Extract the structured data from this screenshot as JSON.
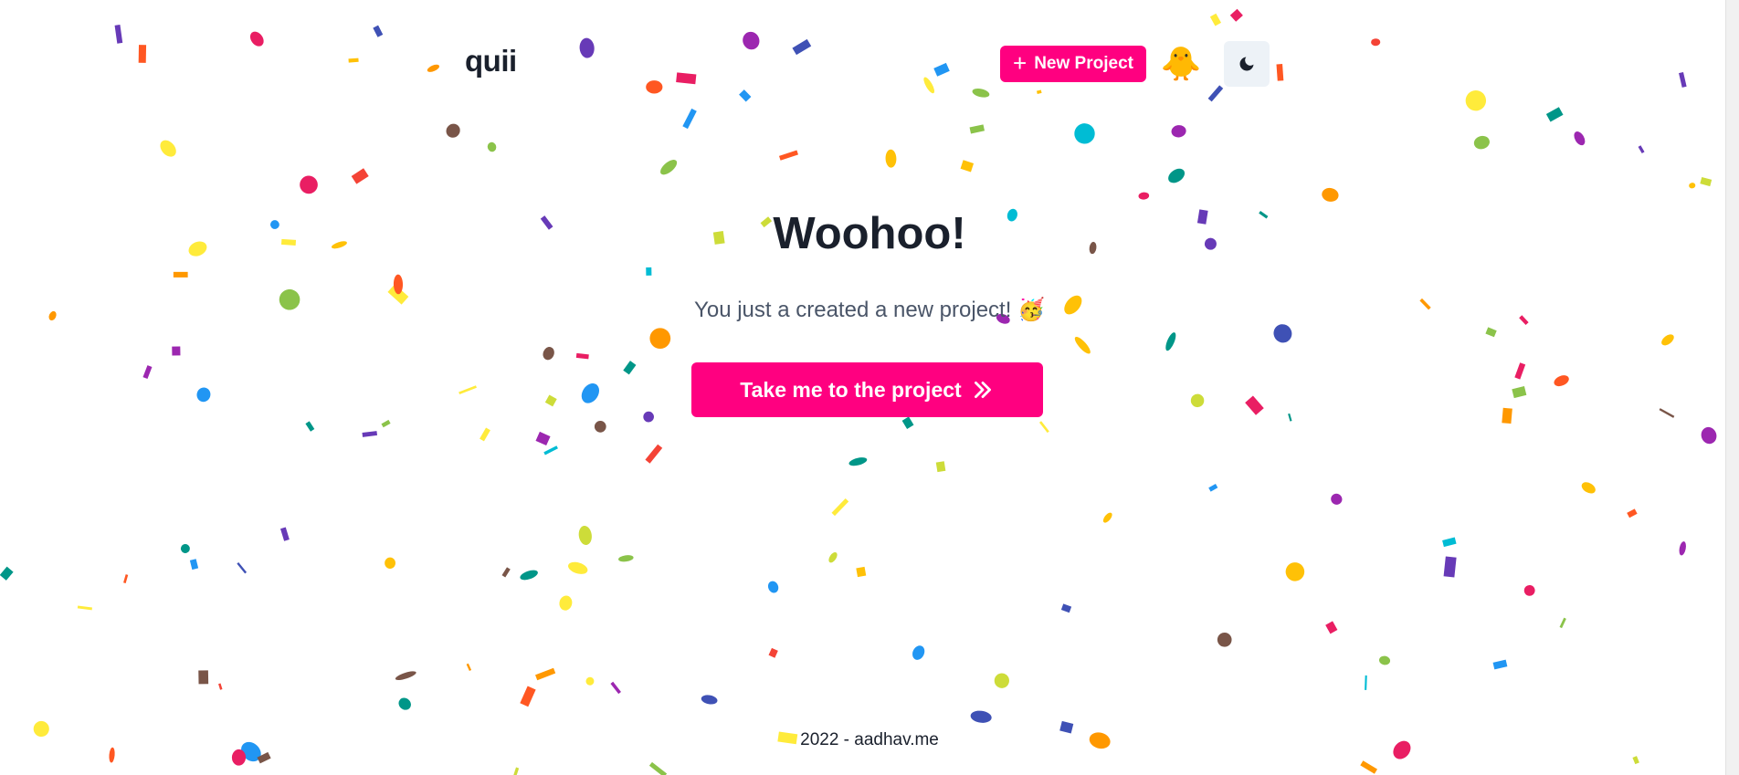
{
  "header": {
    "logo": "quii",
    "new_project_label": "New Project",
    "avatar_emoji": "🐥",
    "theme_toggle_icon": "moon-icon"
  },
  "main": {
    "title": "Woohoo!",
    "subtitle": "You just a created a new project! 🥳",
    "cta_label": "Take me to the project",
    "cta_icon": "double-chevron-right-icon"
  },
  "footer": {
    "text": "2022 - aadhav.me"
  },
  "colors": {
    "accent": "#ff0080",
    "text_dark": "#1a202c",
    "text_muted": "#4a5568",
    "toggle_bg": "#edf2f7",
    "confetti": [
      "#3f51b5",
      "#2196f3",
      "#00bcd4",
      "#009688",
      "#8bc34a",
      "#cddc39",
      "#ffeb3b",
      "#ffc107",
      "#ff9800",
      "#ff5722",
      "#f44336",
      "#e91e63",
      "#9c27b0",
      "#673ab7",
      "#795548"
    ]
  }
}
